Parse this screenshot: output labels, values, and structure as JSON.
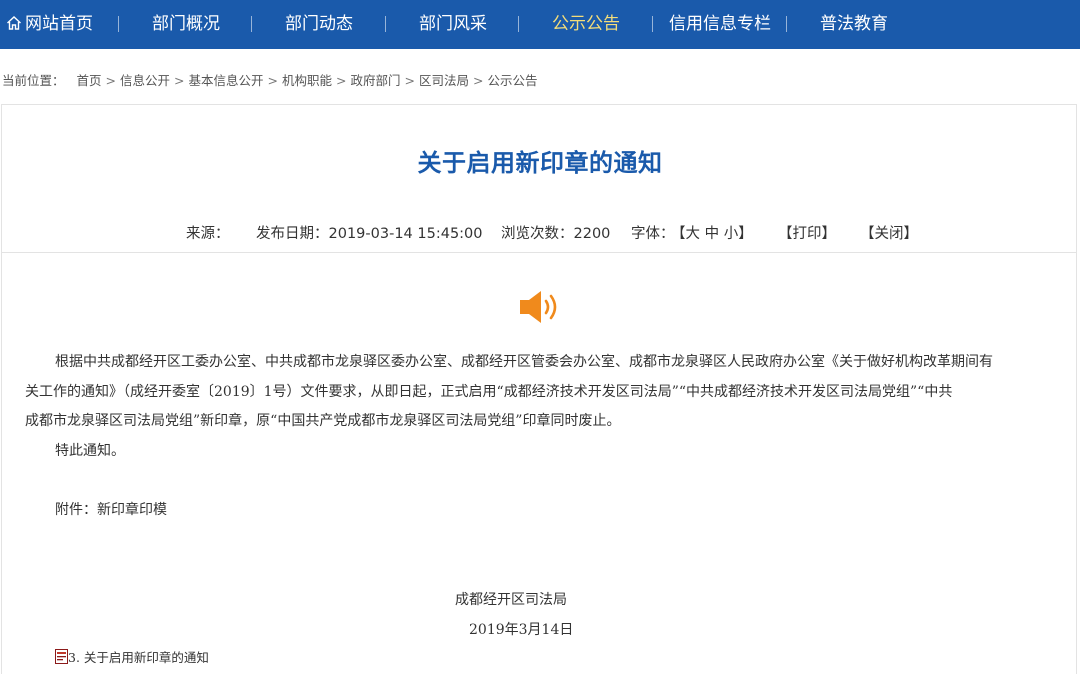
{
  "nav": {
    "items": [
      {
        "label": "网站首页",
        "icon": "home-icon"
      },
      {
        "label": "部门概况"
      },
      {
        "label": "部门动态"
      },
      {
        "label": "部门风采"
      },
      {
        "label": "公示公告",
        "active": true
      },
      {
        "label": "信用信息专栏"
      },
      {
        "label": "普法教育"
      }
    ],
    "bg_color": "#1a5aab",
    "active_color": "#f3dd7a"
  },
  "breadcrumb": {
    "prefix": "当前位置：",
    "items": [
      "首页",
      "信息公开",
      "基本信息公开",
      "机构职能",
      "政府部门",
      "区司法局",
      "公示公告"
    ]
  },
  "article": {
    "title": "关于启用新印章的通知",
    "meta": {
      "source_label": "来源：",
      "date_label": "发布日期：",
      "date_value": "2019-03-14 15:45:00",
      "views_label": "浏览次数：",
      "views_value": "2200",
      "font_label": "字体：",
      "font_sizes": "【大 中 小】",
      "print": "【打印】",
      "close": "【关闭】"
    },
    "speaker_icon": "speaker-icon",
    "paragraph_lines": [
      "根据中共成都经开区工委办公室、中共成都市龙泉驿区委办公室、成都经开区管委会办公室、成都市龙泉驿区人民政府办公室《关于做好机构改革期间有",
      "关工作的通知》（成经开委室〔2019〕1号）文件要求，从即日起，正式启用“成都经济技术开发区司法局”“中共成都经济技术开发区司法局党组”“中共",
      "成都市龙泉驿区司法局党组”新印章，原“中国共产党成都市龙泉驿区司法局党组”印章同时废止。"
    ],
    "notice_end": "特此通知。",
    "attachment_line": "附件：新印章印模",
    "signature_org": "成都经开区司法局",
    "signature_date": "2019年3月14日",
    "attachment_file": "3. 关于启用新印章的通知"
  }
}
